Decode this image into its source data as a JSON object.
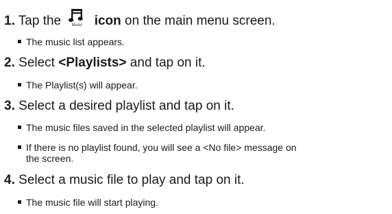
{
  "steps": [
    {
      "number": "1.",
      "pre": "Tap the",
      "icon_name": "music-icon",
      "icon_caption": "Music",
      "bold": "icon",
      "post": " on the main menu screen.",
      "bullets": [
        "The music list appears."
      ]
    },
    {
      "number": "2.",
      "pre": "Select ",
      "bold": "<Playlists>",
      "post": " and tap on it.",
      "bullets": [
        "The Playlist(s) will appear."
      ]
    },
    {
      "number": "3.",
      "pre": "Select a desired playlist and tap on it.",
      "bullets": [
        "The music files saved in the selected playlist will appear.",
        "If there is no playlist found, you will see a <No file> message on",
        "the screen."
      ]
    },
    {
      "number": "4.",
      "pre": "Select a music file to play and tap on it.",
      "bullets": [
        "The music file will start playing."
      ]
    }
  ]
}
